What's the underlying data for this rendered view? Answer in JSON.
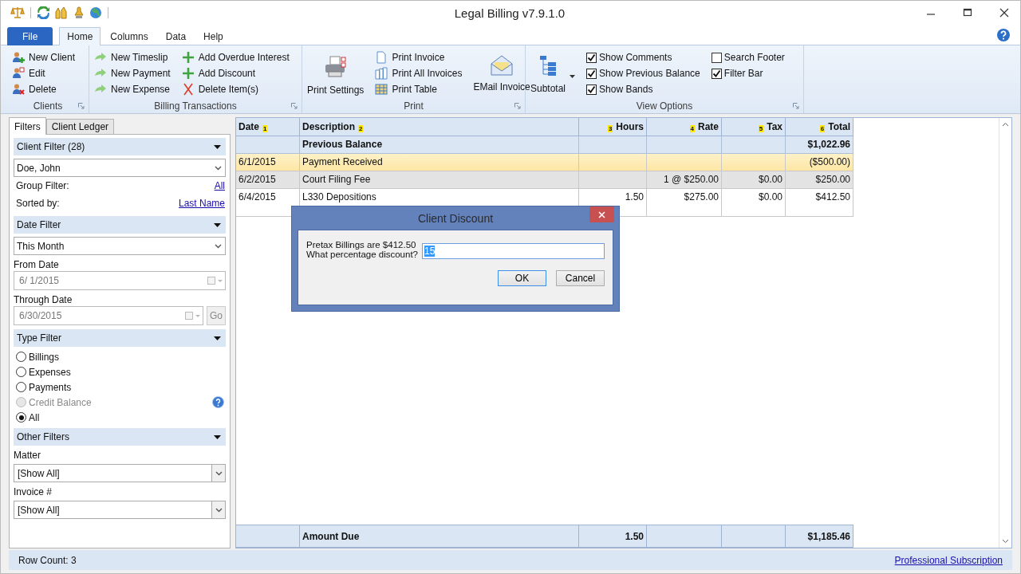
{
  "window": {
    "title": "Legal Billing v7.9.1.0"
  },
  "ribbon_tabs": [
    {
      "label": "File",
      "kind": "file",
      "selected": false
    },
    {
      "label": "Home",
      "kind": "tab",
      "selected": true
    },
    {
      "label": "Columns",
      "kind": "tab",
      "selected": false
    },
    {
      "label": "Data",
      "kind": "tab",
      "selected": false
    },
    {
      "label": "Help",
      "kind": "tab",
      "selected": false
    }
  ],
  "ribbon_groups": [
    {
      "title": "Clients",
      "columns": [
        [
          {
            "kind": "small",
            "label": "New Client"
          },
          {
            "kind": "small",
            "label": "Edit"
          },
          {
            "kind": "small",
            "label": "Delete"
          }
        ]
      ]
    },
    {
      "title": "Billing Transactions",
      "columns": [
        [
          {
            "kind": "small",
            "label": "New Timeslip"
          },
          {
            "kind": "small",
            "label": "New Payment"
          },
          {
            "kind": "small",
            "label": "New Expense"
          }
        ],
        [
          {
            "kind": "small",
            "label": "Add Overdue Interest"
          },
          {
            "kind": "small",
            "label": "Add Discount"
          },
          {
            "kind": "small",
            "label": "Delete Item(s)"
          }
        ]
      ]
    },
    {
      "title": "Print",
      "columns": [
        [
          {
            "kind": "large",
            "label": "Print Settings"
          }
        ],
        [
          {
            "kind": "small",
            "label": "Print Invoice"
          },
          {
            "kind": "small",
            "label": "Print All Invoices"
          },
          {
            "kind": "small",
            "label": "Print Table"
          }
        ],
        [
          {
            "kind": "large",
            "label": "EMail Invoice"
          }
        ]
      ]
    },
    {
      "title": "View Options",
      "columns": [
        [
          {
            "kind": "split",
            "label": "Subtotal"
          }
        ],
        [
          {
            "kind": "checkbox",
            "label": "Show Comments",
            "checked": true
          },
          {
            "kind": "checkbox",
            "label": "Show Previous Balance",
            "checked": true
          },
          {
            "kind": "checkbox",
            "label": "Show Bands",
            "checked": true
          }
        ],
        [
          {
            "kind": "checkbox",
            "label": "Search Footer",
            "checked": false
          },
          {
            "kind": "checkbox",
            "label": "Filter Bar",
            "checked": true
          }
        ]
      ]
    }
  ],
  "side_tabs": [
    {
      "label": "Filters",
      "selected": true
    },
    {
      "label": "Client Ledger",
      "selected": false
    }
  ],
  "client_filter": {
    "header": "Client Filter (28)",
    "client": "Doe, John",
    "group_label": "Group Filter:",
    "group_link": "All",
    "sorted_label": "Sorted by:",
    "sorted_link": "Last Name"
  },
  "date_filter": {
    "header": "Date Filter",
    "range": "This Month",
    "from_label": "From Date",
    "from_value": "6/  1/2015",
    "through_label": "Through Date",
    "through_value": "6/30/2015",
    "go": "Go"
  },
  "type_filter": {
    "header": "Type Filter",
    "options": [
      {
        "label": "Billings",
        "selected": false,
        "disabled": false
      },
      {
        "label": "Expenses",
        "selected": false,
        "disabled": false
      },
      {
        "label": "Payments",
        "selected": false,
        "disabled": false
      },
      {
        "label": "Credit Balance",
        "selected": false,
        "disabled": true
      },
      {
        "label": "All",
        "selected": true,
        "disabled": false
      }
    ]
  },
  "other_filters": {
    "header": "Other Filters",
    "fields": [
      {
        "label": "Matter",
        "value": "[Show All]"
      },
      {
        "label": "Invoice #",
        "value": "[Show All]"
      }
    ]
  },
  "table": {
    "columns": [
      {
        "label": "Date",
        "index": "1",
        "kind": "text"
      },
      {
        "label": "Description",
        "index": "2",
        "kind": "text"
      },
      {
        "label": "Hours",
        "index": "3",
        "kind": "number"
      },
      {
        "label": "Rate",
        "index": "4",
        "kind": "number"
      },
      {
        "label": "Tax",
        "index": "5",
        "kind": "number"
      },
      {
        "label": "Total",
        "index": "6",
        "kind": "number"
      }
    ],
    "rows": [
      {
        "kind": "balance",
        "cells": [
          null,
          "Previous Balance",
          null,
          null,
          null,
          "$1,022.96"
        ]
      },
      {
        "kind": "payment",
        "cells": [
          "6/1/2015",
          "Payment Received",
          null,
          null,
          null,
          "($500.00)"
        ]
      },
      {
        "kind": "expense",
        "cells": [
          "6/2/2015",
          "Court Filing Fee",
          null,
          "1 @ $250.00",
          "$0.00",
          "$250.00"
        ]
      },
      {
        "kind": "billing",
        "cells": [
          "6/4/2015",
          "L330 Depositions",
          "1.50",
          "$275.00",
          "$0.00",
          "$412.50"
        ]
      }
    ],
    "footer": {
      "label": "Amount Due",
      "hours": "1.50",
      "total": "$1,185.46"
    }
  },
  "status_bar": {
    "row_count": "Row Count:  3",
    "link": "Professional Subscription"
  },
  "dialog": {
    "title": "Client Discount",
    "lines": [
      "Pretax Billings are $412.50",
      "What percentage discount?"
    ],
    "value": "15",
    "buttons": [
      {
        "label": "OK",
        "default": true
      },
      {
        "label": "Cancel",
        "default": false
      }
    ]
  }
}
